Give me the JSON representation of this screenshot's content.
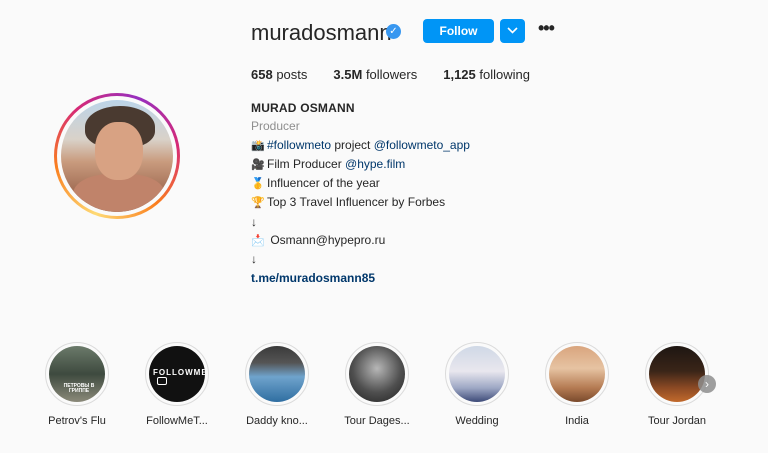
{
  "profile": {
    "username": "muradosmann",
    "follow_label": "Follow",
    "more_label": "•••",
    "stats": {
      "posts_count": "658",
      "posts_label": "posts",
      "followers_count": "3.5M",
      "followers_label": "followers",
      "following_count": "1,125",
      "following_label": "following"
    },
    "bio": {
      "name": "MURAD OSMANN",
      "category": "Producer",
      "lines": [
        {
          "emoji": "📸",
          "text_a": "",
          "tag": "#followmeto",
          "text_b": " project ",
          "mention": "@followmeto_app"
        },
        {
          "emoji": "🎥",
          "text_a": "Film Producer ",
          "mention": "@hype.film"
        },
        {
          "emoji": "🥇",
          "text_a": "Influencer of the year"
        },
        {
          "emoji": "🏆",
          "text_a": "Top 3 Travel Influencer by Forbes"
        },
        {
          "arrow": "↓"
        },
        {
          "emoji": "📩",
          "text_a": " Osmann@hypepro.ru"
        },
        {
          "arrow": "↓"
        }
      ],
      "link": "t.me/muradosmann85"
    }
  },
  "highlights": [
    {
      "label": "Petrov's Flu",
      "overlay": "ПЕТРОВЫ В ГРИППЕ"
    },
    {
      "label": "FollowMeT...",
      "overlay": "FOLLOWMETO"
    },
    {
      "label": "Daddy kno..."
    },
    {
      "label": "Tour Dages..."
    },
    {
      "label": "Wedding"
    },
    {
      "label": "India"
    },
    {
      "label": "Tour Jordan"
    }
  ],
  "colors": {
    "accent": "#0095f6",
    "verified": "#3897f0",
    "link": "#00376b",
    "muted": "#8e8e8e"
  }
}
